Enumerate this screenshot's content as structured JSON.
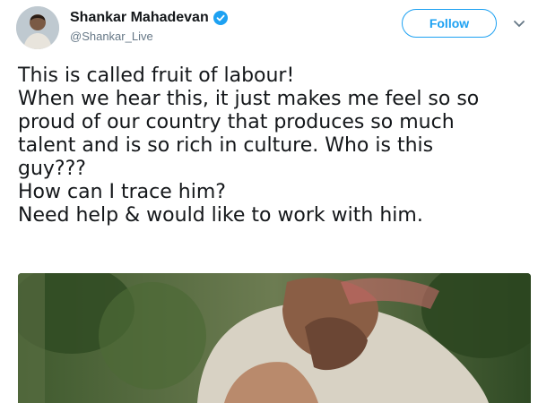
{
  "tweet": {
    "author": {
      "display_name": "Shankar Mahadevan",
      "handle": "@Shankar_Live",
      "verified": true,
      "avatar_icon": "user-avatar-icon",
      "verified_icon": "verified-badge-icon"
    },
    "follow_label": "Follow",
    "menu_icon": "chevron-down-icon",
    "text_lines": [
      "This is called fruit of labour!",
      "When we hear this, it just makes me feel so so",
      "proud of our country that produces so much",
      "talent and is so rich in culture. Who is this",
      "guy???",
      "How can I trace him?",
      "Need help & would like to work with him."
    ]
  },
  "colors": {
    "accent": "#1da1f2",
    "text": "#14171a",
    "secondary_text": "#657786"
  }
}
